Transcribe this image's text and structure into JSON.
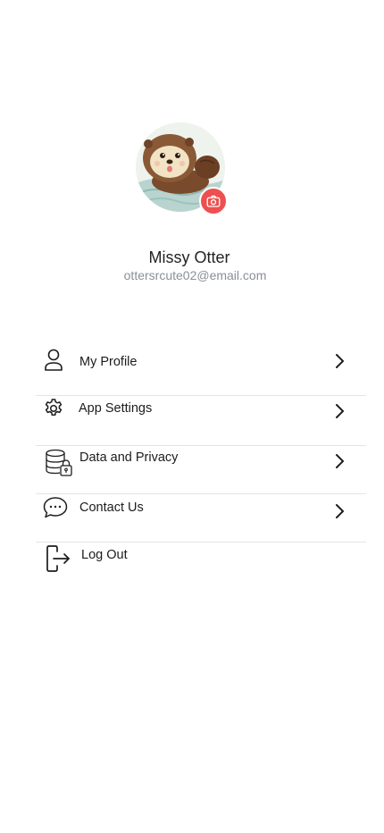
{
  "profile": {
    "name": "Missy Otter",
    "email": "ottersrcute02@email.com"
  },
  "menu": {
    "items": [
      {
        "label": "My Profile",
        "icon": "user-icon"
      },
      {
        "label": "App Settings",
        "icon": "gear-icon"
      },
      {
        "label": "Data and Privacy",
        "icon": "database-lock-icon"
      },
      {
        "label": "Contact Us",
        "icon": "chat-bubble-icon"
      },
      {
        "label": "Log Out",
        "icon": "logout-icon"
      }
    ]
  },
  "colors": {
    "camera_button": "#ee4f4f",
    "email_text": "#8a8f98",
    "divider": "#e4e4e4"
  }
}
